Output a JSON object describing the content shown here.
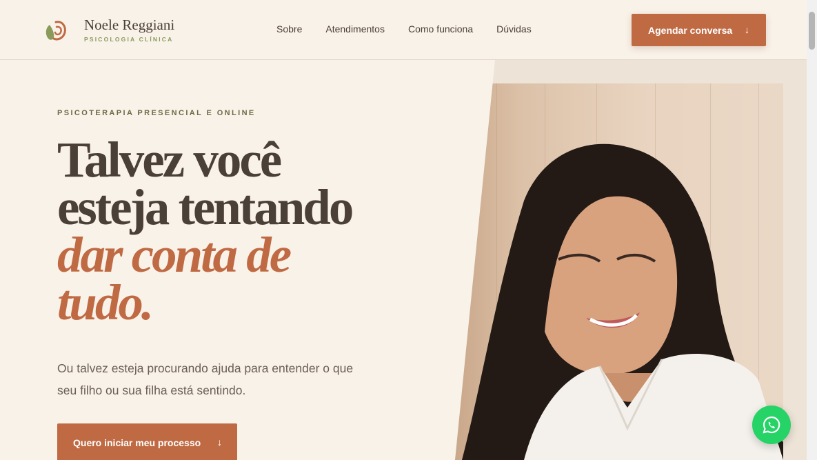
{
  "brand": {
    "name": "Noele Reggiani",
    "subtitle": "PSICOLOGIA CLÍNICA"
  },
  "nav": {
    "items": [
      {
        "label": "Sobre"
      },
      {
        "label": "Atendimentos"
      },
      {
        "label": "Como funciona"
      },
      {
        "label": "Dúvidas"
      }
    ]
  },
  "header_cta": {
    "label": "Agendar conversa",
    "arrow": "↓"
  },
  "hero": {
    "eyebrow": "PSICOTERAPIA PRESENCIAL E ONLINE",
    "headline_line1": "Talvez você",
    "headline_line2": "esteja tentando",
    "headline_em1": "dar conta de",
    "headline_em2": "tudo.",
    "lead": "Ou talvez esteja procurando ajuda para entender o que seu filho ou sua filha está sentindo.",
    "cta_label": "Quero iniciar meu processo",
    "cta_arrow": "↓"
  },
  "colors": {
    "accent": "#c06a44",
    "background": "#f9f2e9",
    "text": "#4a4038",
    "olive": "#8a9a5b",
    "whatsapp": "#25d366"
  },
  "icons": {
    "logo": "spiral-leaf-logo-icon",
    "whatsapp": "whatsapp-icon",
    "arrow": "arrow-down-icon"
  }
}
